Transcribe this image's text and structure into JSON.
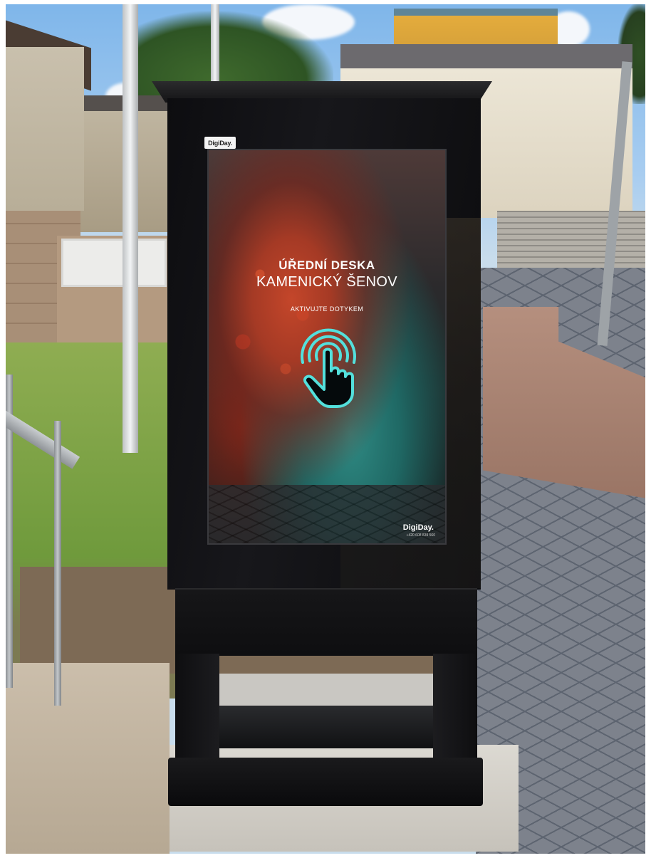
{
  "kiosk": {
    "frame_logo": "DigiDay.",
    "screen": {
      "title": "ÚŘEDNÍ DESKA",
      "subtitle": "KAMENICKÝ ŠENOV",
      "hint": "AKTIVUJTE DOTYKEM",
      "icon": "touch-hand-icon",
      "brand": "DigiDay.",
      "phone": "+420 608 839 560"
    },
    "colors": {
      "frame": "#111114",
      "screen_text": "#ffffff",
      "icon_glow": "#53e0dc"
    }
  }
}
